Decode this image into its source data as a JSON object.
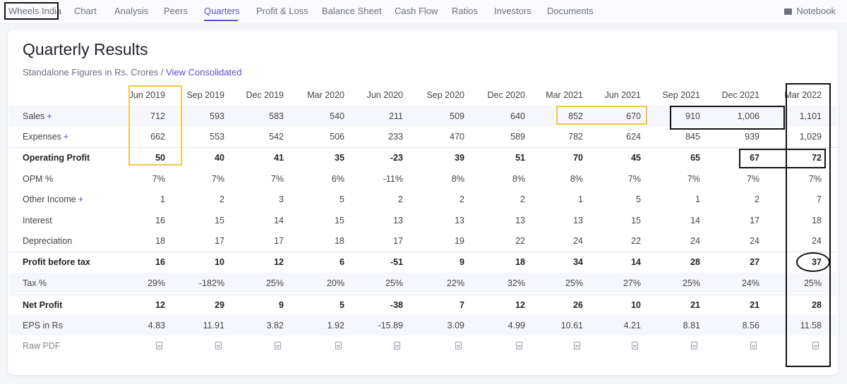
{
  "nav": {
    "items": [
      "Wheels India",
      "Chart",
      "Analysis",
      "Peers",
      "Quarters",
      "Profit & Loss",
      "Balance Sheet",
      "Cash Flow",
      "Ratios",
      "Investors",
      "Documents"
    ],
    "active": "Quarters",
    "notebook": "Notebook"
  },
  "card": {
    "title": "Quarterly Results",
    "subtitle_prefix": "Standalone Figures in Rs. Crores /",
    "subtitle_link": "View Consolidated"
  },
  "columns": [
    "Jun 2019",
    "Sep 2019",
    "Dec 2019",
    "Mar 2020",
    "Jun 2020",
    "Sep 2020",
    "Dec 2020",
    "Mar 2021",
    "Jun 2021",
    "Sep 2021",
    "Dec 2021",
    "Mar 2022"
  ],
  "rows": [
    {
      "label": "Sales",
      "plus": "+",
      "bold": false,
      "values": [
        "712",
        "593",
        "583",
        "540",
        "211",
        "509",
        "640",
        "852",
        "670",
        "910",
        "1,006",
        "1,101"
      ]
    },
    {
      "label": "Expenses",
      "plus": "+",
      "bold": false,
      "values": [
        "662",
        "553",
        "542",
        "506",
        "233",
        "470",
        "589",
        "782",
        "624",
        "845",
        "939",
        "1,029"
      ]
    },
    {
      "label": "Operating Profit",
      "plus": "",
      "bold": true,
      "values": [
        "50",
        "40",
        "41",
        "35",
        "-23",
        "39",
        "51",
        "70",
        "45",
        "65",
        "67",
        "72"
      ]
    },
    {
      "label": "OPM %",
      "plus": "",
      "bold": false,
      "values": [
        "7%",
        "7%",
        "7%",
        "6%",
        "-11%",
        "8%",
        "8%",
        "8%",
        "7%",
        "7%",
        "7%",
        "7%"
      ]
    },
    {
      "label": "Other Income",
      "plus": "+",
      "bold": false,
      "values": [
        "1",
        "2",
        "3",
        "5",
        "2",
        "2",
        "2",
        "1",
        "5",
        "1",
        "2",
        "7"
      ]
    },
    {
      "label": "Interest",
      "plus": "",
      "bold": false,
      "values": [
        "16",
        "15",
        "14",
        "15",
        "13",
        "13",
        "13",
        "13",
        "15",
        "14",
        "17",
        "18"
      ]
    },
    {
      "label": "Depreciation",
      "plus": "",
      "bold": false,
      "values": [
        "18",
        "17",
        "17",
        "18",
        "17",
        "19",
        "22",
        "24",
        "22",
        "24",
        "24",
        "24"
      ]
    },
    {
      "label": "Profit before tax",
      "plus": "",
      "bold": true,
      "values": [
        "16",
        "10",
        "12",
        "6",
        "-51",
        "9",
        "18",
        "34",
        "14",
        "28",
        "27",
        "37"
      ]
    },
    {
      "label": "Tax %",
      "plus": "",
      "bold": false,
      "values": [
        "29%",
        "-182%",
        "25%",
        "20%",
        "25%",
        "22%",
        "32%",
        "25%",
        "27%",
        "25%",
        "24%",
        "25%"
      ]
    },
    {
      "label": "Net Profit",
      "plus": "",
      "bold": true,
      "values": [
        "12",
        "29",
        "9",
        "5",
        "-38",
        "7",
        "12",
        "26",
        "10",
        "21",
        "21",
        "28"
      ]
    },
    {
      "label": "EPS in Rs",
      "plus": "",
      "bold": false,
      "values": [
        "4.83",
        "11.91",
        "3.82",
        "1.92",
        "-15.89",
        "3.09",
        "4.99",
        "10.61",
        "4.21",
        "8.81",
        "8.56",
        "11.58"
      ]
    }
  ],
  "raw_pdf": {
    "label": "Raw PDF",
    "icon": "pdf-file-icon"
  },
  "colors": {
    "accent": "#5a4fcf",
    "highlight_yellow": "#f2c744",
    "annotation_black": "#111111"
  }
}
